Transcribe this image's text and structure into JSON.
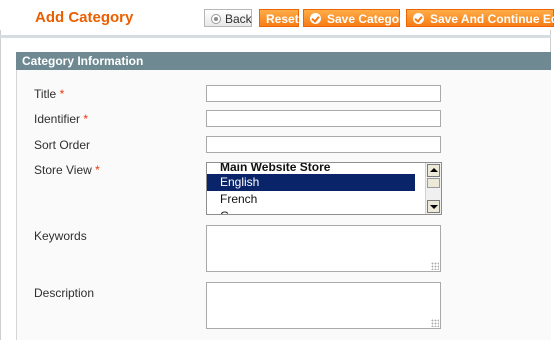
{
  "header": {
    "title": "Add Category",
    "buttons": {
      "back": "Back",
      "reset": "Reset",
      "save": "Save Category",
      "save_continue": "Save And Continue Edit"
    }
  },
  "section": {
    "title": "Category Information"
  },
  "form": {
    "required_marker": "*",
    "title": {
      "label": "Title",
      "value": ""
    },
    "identifier": {
      "label": "Identifier",
      "value": ""
    },
    "sort_order": {
      "label": "Sort Order",
      "value": ""
    },
    "store_view": {
      "label": "Store View",
      "group": "Main Website Store",
      "options": [
        "English",
        "French",
        "G"
      ],
      "selected": "English"
    },
    "keywords": {
      "label": "Keywords",
      "value": ""
    },
    "description": {
      "label": "Description",
      "value": ""
    }
  },
  "colors": {
    "accent": "#eb5e00",
    "section_header": "#6f8992",
    "selected_option": "#0a246a"
  },
  "icons": {
    "back": "back-circle-icon",
    "save": "check-circle-icon"
  }
}
